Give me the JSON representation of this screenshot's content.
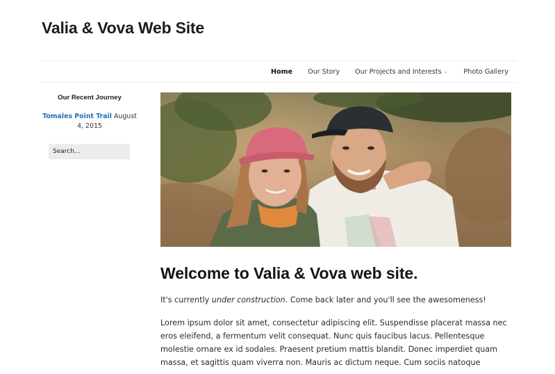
{
  "site": {
    "title": "Valia & Vova Web Site"
  },
  "nav": {
    "items": [
      {
        "label": "Home"
      },
      {
        "label": "Our Story"
      },
      {
        "label": "Our Projects and Interests"
      },
      {
        "label": "Photo Gallery"
      }
    ]
  },
  "sidebar": {
    "widget_title": "Our Recent Journey",
    "journey_link": "Tomales Point Trail",
    "journey_date": "August 4, 2015",
    "search_placeholder": "Search..."
  },
  "main": {
    "heading": "Welcome to Valia & Vova web site.",
    "intro_before": "It's currently ",
    "intro_em": "under construction",
    "intro_after": ". Come back later and you'll see the awesomeness!",
    "lorem_lines": [
      "Lorem ipsum dolor sit amet, consectetur adipiscing elit. Suspendisse placerat massa nec",
      "eros eleifend, a fermentum velit consequat. Nunc quis faucibus lacus. Pellentesque",
      "molestie ornare ex id sodales. Praesent pretium mattis blandit. Donec imperdiet quam",
      "massa, et sagittis quam viverra non. Mauris ac dictum neque. Cum sociis natoque"
    ]
  }
}
